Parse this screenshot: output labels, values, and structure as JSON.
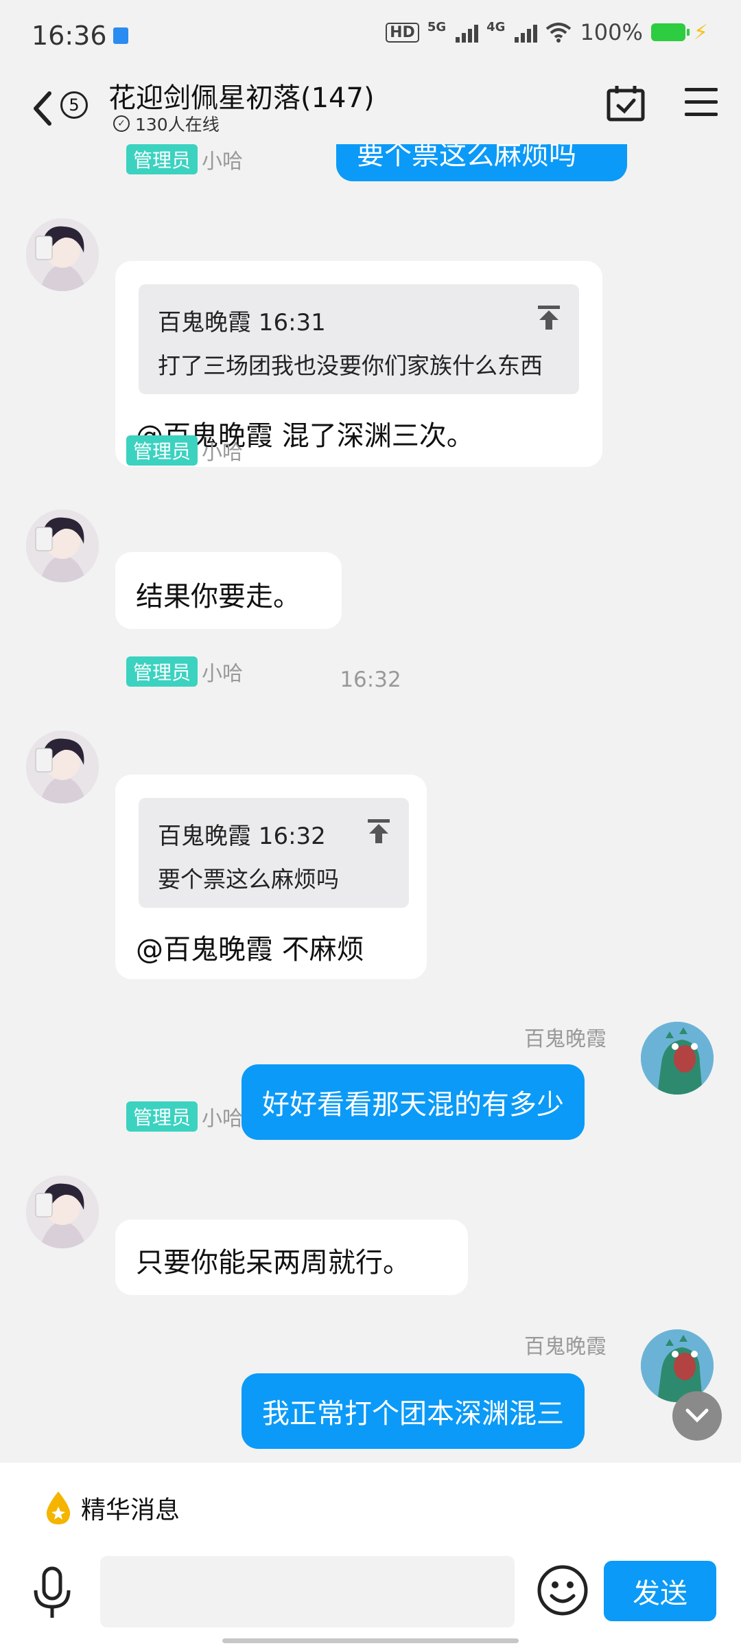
{
  "status_bar": {
    "time": "16:36",
    "network_1": "5G",
    "network_2": "4G",
    "battery": "100%",
    "hd_label": "HD"
  },
  "header": {
    "unread_count": "5",
    "title": "花迎剑佩星初落(147)",
    "online_text": "130人在线",
    "icons": [
      "back-icon",
      "calendar-check-icon",
      "menu-icon"
    ]
  },
  "chat": {
    "top_partial_bubble": "要个票这么麻烦吗",
    "messages": [
      {
        "side": "left",
        "role_tag": "管理员",
        "sender": "小哈",
        "quote": {
          "author_time": "百鬼晚霞 16:31",
          "text": "打了三场团我也没要你们家族什么东西"
        },
        "text": "@百鬼晚霞 混了深渊三次。"
      },
      {
        "side": "left",
        "role_tag": "管理员",
        "sender": "小哈",
        "text": "结果你要走。"
      },
      {
        "type": "time",
        "text": "16:32"
      },
      {
        "side": "left",
        "role_tag": "管理员",
        "sender": "小哈",
        "quote": {
          "author_time": "百鬼晚霞 16:32",
          "text": "要个票这么麻烦吗"
        },
        "text": "@百鬼晚霞 不麻烦"
      },
      {
        "side": "right",
        "sender": "百鬼晚霞",
        "text": "好好看看那天混的有多少"
      },
      {
        "side": "left",
        "role_tag": "管理员",
        "sender": "小哈",
        "text": "只要你能呆两周就行。"
      },
      {
        "side": "right",
        "sender": "百鬼晚霞",
        "text": "我正常打个团本深渊混三"
      }
    ]
  },
  "bottom": {
    "essence_label": "精华消息",
    "input_value": "",
    "send_label": "发送"
  },
  "colors": {
    "accent": "#0b9af7",
    "admin_tag": "#3bd2c0",
    "background": "#f2f2f2"
  }
}
